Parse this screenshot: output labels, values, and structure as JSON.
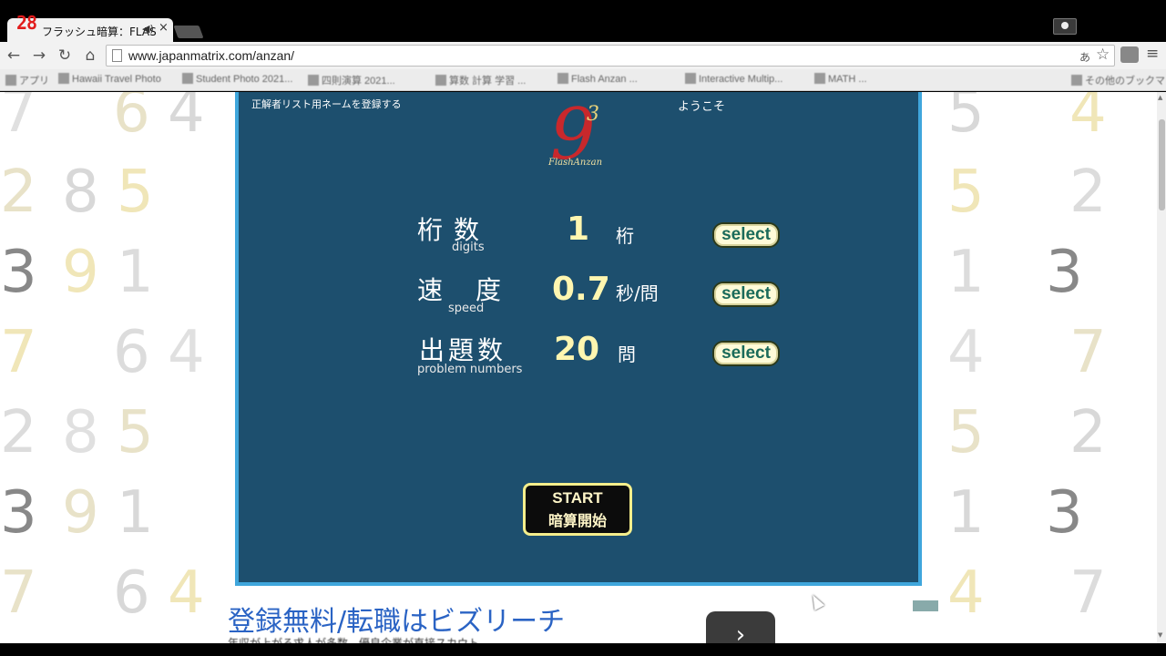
{
  "browser": {
    "tab": {
      "favicon_text": "28",
      "title": "フラッシュ暗算：FLAS",
      "audio_icon": "speaker-icon",
      "close_glyph": "×"
    },
    "toolbar": {
      "back_glyph": "←",
      "forward_glyph": "→",
      "reload_glyph": "↻",
      "home_glyph": "⌂",
      "url": "www.japanmatrix.com/anzan/",
      "star_glyph": "☆",
      "menu_glyph": "≡"
    },
    "bookmarks": [
      "アプリ",
      "Hawaii Travel Photo",
      "Student Photo 2021...",
      "四則演算 2021...",
      "算数 計算 学習 ...",
      "Flash Anzan ...",
      "Interactive Multip...",
      "MATH ...",
      "その他のブックマーク"
    ]
  },
  "page": {
    "background_digit_rows": [
      [
        "7",
        "6",
        "4"
      ],
      [
        "2",
        "8",
        "5"
      ],
      [
        "3",
        "9",
        "1"
      ],
      [
        "7",
        "6",
        "4"
      ],
      [
        "2",
        "8",
        "5"
      ],
      [
        "3",
        "9",
        "1"
      ],
      [
        "7",
        "6",
        "4"
      ]
    ],
    "background_digit_rows_right": [
      [
        "5",
        "4"
      ],
      [
        "5",
        "2"
      ],
      [
        "1",
        "3"
      ],
      [
        "4",
        "7"
      ],
      [
        "5",
        "2"
      ],
      [
        "1",
        "3"
      ],
      [
        "4",
        "7"
      ]
    ],
    "flash": {
      "register_link": "正解者リスト用ネームを登録する",
      "welcome": "ようこそ",
      "logo_digit": "9",
      "logo_superscript": "3",
      "logo_text": "FlashAnzan",
      "rows": [
        {
          "label": "桁数",
          "sublabel": "digits",
          "value": "1",
          "unit": "桁",
          "button": "select"
        },
        {
          "label": "速度",
          "sublabel": "speed",
          "value": "0.7",
          "unit": "秒/問",
          "button": "select"
        },
        {
          "label": "出題数",
          "sublabel": "problem numbers",
          "value": "20",
          "unit": "問",
          "button": "select"
        }
      ],
      "start_en": "START",
      "start_ja": "暗算開始"
    },
    "ad": {
      "headline": "登録無料/転職はビズリーチ",
      "subtext": "年収が上がる求人が多数。優良企業が直接スカウト。",
      "arrow_glyph": "›"
    }
  },
  "colors": {
    "flash_bg": "#1d4f6e",
    "flash_border": "#3fa6dc",
    "value_yellow": "#fff6b0",
    "select_text": "#1b6b5a",
    "ad_blue": "#2a63c4"
  }
}
